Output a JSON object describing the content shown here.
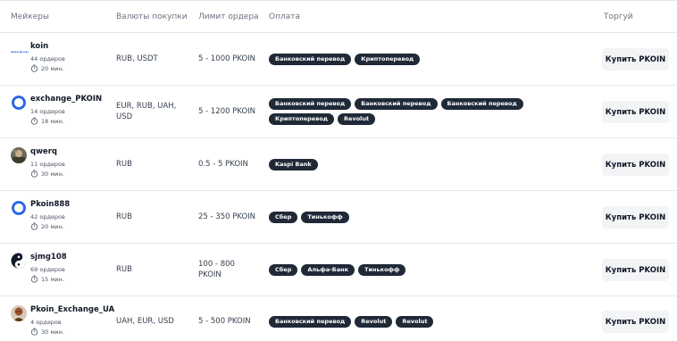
{
  "header": {
    "makers": "Мейкеры",
    "currencies": "Валюты покупки",
    "limit": "Лимит ордера",
    "payment": "Оплата",
    "trade": "Торгуй"
  },
  "rows": [
    {
      "name": "koin",
      "orders": "44 ордеров",
      "time": "20 мин.",
      "avatar": "pkoin-logo-avatar",
      "currencies": "RUB, USDT",
      "limit": "5 - 1000 PKOIN",
      "payments": [
        "Банковский перевод",
        "Криптоперевод"
      ],
      "button": "Купить PKOIN"
    },
    {
      "name": "exchange_PKOIN",
      "orders": "14 ордеров",
      "time": "18 мин.",
      "avatar": "ring-avatar",
      "currencies": "EUR, RUB, UAH, USD",
      "limit": "5 - 1200 PKOIN",
      "payments": [
        "Банковский перевод",
        "Банковский перевод",
        "Банковский перевод",
        "Криптоперевод",
        "Revolut"
      ],
      "button": "Купить PKOIN"
    },
    {
      "name": "qwerq",
      "orders": "11 ордеров",
      "time": "30 мин.",
      "avatar": "photo-avatar",
      "currencies": "RUB",
      "limit": "0.5 - 5 PKOIN",
      "payments": [
        "Kaspi Bank"
      ],
      "button": "Купить PKOIN"
    },
    {
      "name": "Pkoin888",
      "orders": "42 ордеров",
      "time": "20 мин.",
      "avatar": "ring-avatar",
      "currencies": "RUB",
      "limit": "25 - 350 PKOIN",
      "payments": [
        "Сбер",
        "Тинькофф"
      ],
      "button": "Купить PKOIN"
    },
    {
      "name": "sjmg108",
      "orders": "69 ордеров",
      "time": "15 мин.",
      "avatar": "yin-yang-avatar",
      "currencies": "RUB",
      "limit": "100 - 800 PKOIN",
      "payments": [
        "Сбер",
        "Альфа-Банк",
        "Тинькофф"
      ],
      "button": "Купить PKOIN"
    },
    {
      "name": "Pkoin_Exchange_UA",
      "orders": "4 ордеров",
      "time": "30 мин.",
      "avatar": "character-avatar",
      "currencies": "UAH, EUR, USD",
      "limit": "5 - 500 PKOIN",
      "payments": [
        "Банковский перевод",
        "Revolut",
        "Revolut"
      ],
      "button": "Купить PKOIN"
    }
  ],
  "colors": {
    "chip_bg": "#1f2937",
    "ring_blue": "#2563eb",
    "button_bg": "#f3f4f6"
  }
}
